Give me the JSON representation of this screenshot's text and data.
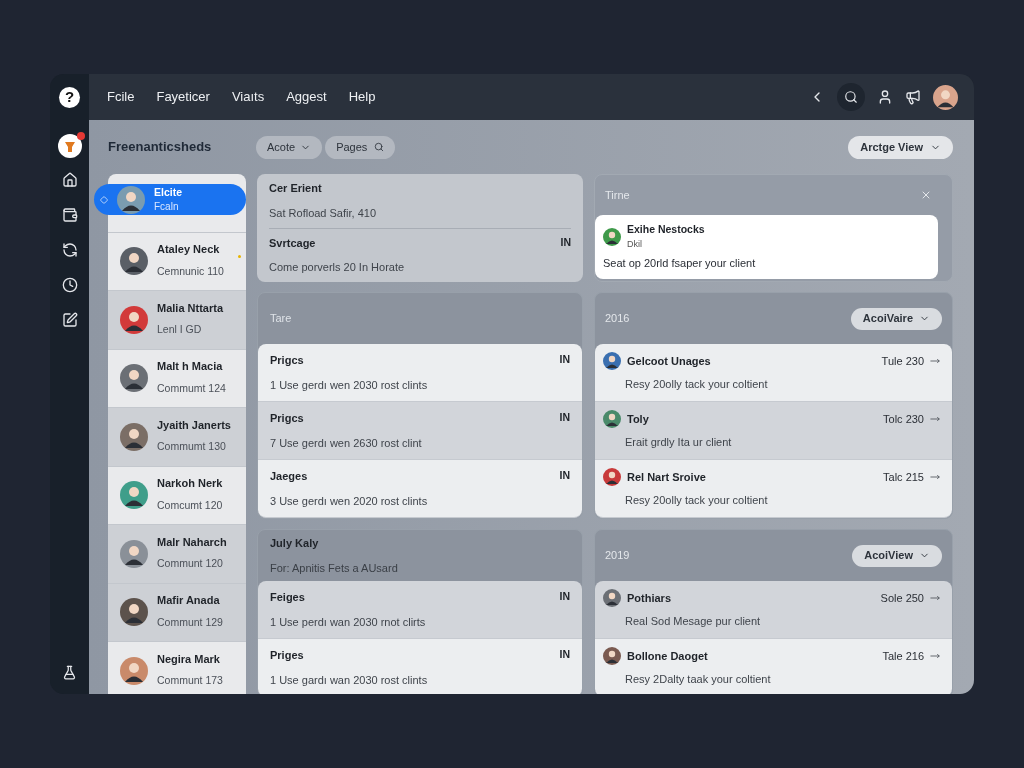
{
  "rail": {
    "help_glyph": "?",
    "avatar_badge": true
  },
  "menu": [
    "Fcile",
    "Fayeticer",
    "Viaıts",
    "Aggest",
    "Help"
  ],
  "header": {
    "title": "Freenanticsheds",
    "filter": "Acote",
    "search": "Pages",
    "view_button": "Arctge View"
  },
  "contacts": [
    {
      "name": "Elcite",
      "subtitle": "Fcaln",
      "selected": true,
      "highlighted": false,
      "unread": false,
      "color": "#7a9cb0"
    },
    {
      "name": "Ataley Neck",
      "subtitle": "Cemnunic 110",
      "selected": false,
      "highlighted": false,
      "unread": true,
      "color": "#5a5f66"
    },
    {
      "name": "Malia Nttarta",
      "subtitle": "Lenl I GD",
      "selected": false,
      "highlighted": true,
      "unread": false,
      "color": "#d23a3a"
    },
    {
      "name": "Malt h Macia",
      "subtitle": "Commumt 124",
      "selected": false,
      "highlighted": false,
      "unread": false,
      "color": "#6b6f75"
    },
    {
      "name": "Jyaith Janerts",
      "subtitle": "Commumt 130",
      "selected": false,
      "highlighted": true,
      "unread": false,
      "color": "#7b6e66"
    },
    {
      "name": "Narkoh Nerk",
      "subtitle": "Comcumt 120",
      "selected": false,
      "highlighted": false,
      "unread": false,
      "color": "#3f9e8a"
    },
    {
      "name": "Malr Naharch",
      "subtitle": "Communt 120",
      "selected": false,
      "highlighted": true,
      "unread": false,
      "color": "#8a9098"
    },
    {
      "name": "Mafir Anada",
      "subtitle": "Communt 129",
      "selected": false,
      "highlighted": true,
      "unread": false,
      "color": "#5c524c"
    },
    {
      "name": "Negira Mark",
      "subtitle": "Communt 173",
      "selected": false,
      "highlighted": false,
      "unread": false,
      "color": "#c98a6a"
    }
  ],
  "middle": {
    "top_card": [
      {
        "title": "Cer Erient",
        "subtitle": "Sat Rofload Safir, 410"
      },
      {
        "title": "Svrtcage",
        "subtitle": "Come porverls 20 In Horate",
        "tag": "IN"
      }
    ],
    "groups": [
      {
        "title": "Tare",
        "items": [
          {
            "title": "Prigcs",
            "subtitle": "1 Use gerdı wen 2030 rost clints",
            "tag": "IN",
            "highlighted": false
          },
          {
            "title": "Prigcs",
            "subtitle": "7 Use gerdı wen 2630 rost clint",
            "tag": "IN",
            "highlighted": true
          },
          {
            "title": "Jaeges",
            "subtitle": "3 Use gerdı wen 2020 rost clints",
            "tag": "IN",
            "highlighted": false
          }
        ]
      },
      {
        "title": "July Kaly",
        "subtitle": "For: Apnitis Fets a AUsard",
        "items": [
          {
            "title": "Feiges",
            "subtitle": "1 Use perdı wan 2030 rnot clirts",
            "tag": "IN",
            "highlighted": true
          },
          {
            "title": "Priges",
            "subtitle": "1 Use gardı wan 2030 rost clints",
            "tag": "IN",
            "highlighted": false
          }
        ]
      }
    ]
  },
  "right": {
    "notice": {
      "title": "Tirne",
      "name": "Exihe Nestocks",
      "meta": "Dkil",
      "text": "Seat op 20rld fsaper your client",
      "color": "#3f9a4a"
    },
    "groups": [
      {
        "title": "2016",
        "button": "AcoiVaire",
        "items": [
          {
            "name": "Gelcoot Unages",
            "time": "Tule 230",
            "text": "Resy 20olly tack your coltient",
            "highlighted": false,
            "color": "#3a6fb0"
          },
          {
            "name": "Toly",
            "time": "Tolc 230",
            "text": "Erait grdly Ita ur client",
            "highlighted": true,
            "color": "#4a8a6a"
          },
          {
            "name": "Rel Nart Sroive",
            "time": "Talc 215",
            "text": "Resy 20olly tack your coltient",
            "highlighted": false,
            "color": "#c83a3a"
          }
        ]
      },
      {
        "title": "2019",
        "button": "AcoiView",
        "items": [
          {
            "name": "Pothiars",
            "time": "Sole 250",
            "text": "Real Sod Mesage pur client",
            "highlighted": true,
            "color": "#6b6f75"
          },
          {
            "name": "Bollone Daoget",
            "time": "Tale 216",
            "text": "Resy 2Dalty taak your coltient",
            "highlighted": false,
            "color": "#7a5a50"
          }
        ]
      }
    ]
  }
}
